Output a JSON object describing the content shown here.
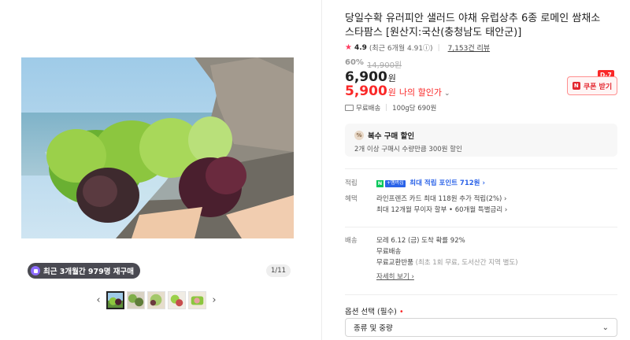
{
  "product": {
    "title": "당일수확 유러피안 샐러드 야채 유럽상추 6종 로메인 쌈채소 스타팜스 [원산지:국산(충청남도 태안군)]",
    "rating": {
      "star": "★",
      "score": "4.9",
      "recent": "(최근 6개월 4.91ⓘ)",
      "reviews": "7,153건 리뷰"
    },
    "discount_pct": "60%",
    "original_price": "14,900원",
    "price": "6,900",
    "price_unit": "원",
    "my_price": "5,900",
    "my_price_unit": "원",
    "my_price_label": "나의 할인가",
    "coupon": {
      "n": "N",
      "label": "쿠폰 받기",
      "dday": "D-7"
    },
    "shipping_line": {
      "free": "무료배송",
      "unit_price": "100g당 690원"
    }
  },
  "gallery": {
    "rebuy_badge": "최근 3개월간 979명 재구매",
    "page_counter": "1/11",
    "prev": "‹",
    "next": "›"
  },
  "multi_buy": {
    "title": "복수 구매 할인",
    "desc": "2개 이상 구매시 수량만큼 300원 할인"
  },
  "info": {
    "points_key": "적립",
    "points_npay_n": "N",
    "points_npay_plus": "+멤버십",
    "points_value": "최대 적립 포인트 712원 ›",
    "benefit_key": "혜택",
    "benefit_line1": "라인프렌즈 카드 최대 118원 추가 적립(2%) ›",
    "benefit_line2": "최대 12개월 무이자 할부 • 60개월 특별금리 ›",
    "delivery_key": "배송",
    "delivery_line1": "모레 6.12 (금) 도착 확률 92%",
    "delivery_line2": "무료배송",
    "delivery_line3": "무료교환반품",
    "delivery_line3_sub": "(최초 1회 무료, 도서산간 지역 별도)",
    "delivery_detail": "자세히 보기 ›"
  },
  "option": {
    "label": "옵션 선택 (필수)",
    "required_mark": "•",
    "select_value": "종류 및 중량",
    "chevron": "⌄"
  },
  "colors": {
    "accent_red": "#fa2828",
    "star": "#ff3a5e",
    "npay_green": "#03c75a",
    "link_blue": "#2b63e8"
  }
}
